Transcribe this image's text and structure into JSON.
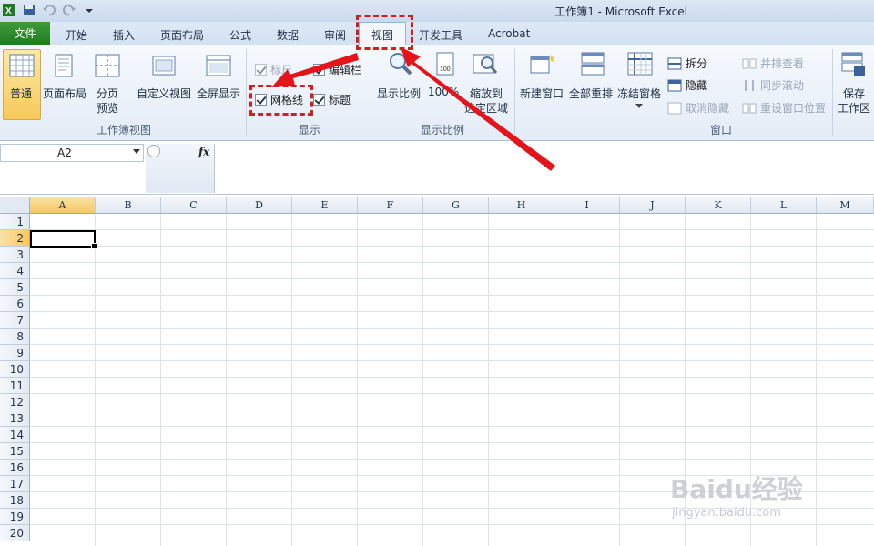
{
  "window": {
    "title": "工作簿1 - Microsoft Excel"
  },
  "tabs": {
    "file": "文件",
    "home": "开始",
    "insert": "插入",
    "page_layout": "页面布局",
    "formulas": "公式",
    "data": "数据",
    "review": "审阅",
    "view": "视图",
    "developer": "开发工具",
    "acrobat": "Acrobat"
  },
  "ribbon": {
    "workbook_views": {
      "label": "工作簿视图",
      "normal": "普通",
      "page_layout": "页面布局",
      "page_break_1": "分页",
      "page_break_2": "预览",
      "custom_views": "自定义视图",
      "full_screen": "全屏显示"
    },
    "show": {
      "label": "显示",
      "ruler": "标尺",
      "formula_bar": "编辑栏",
      "gridlines": "网格线",
      "headings": "标题"
    },
    "zoom": {
      "label": "显示比例",
      "zoom": "显示比例",
      "hundred": "100%",
      "zoom_to_selection_1": "缩放到",
      "zoom_to_selection_2": "选定区域"
    },
    "window": {
      "label": "窗口",
      "new_window": "新建窗口",
      "arrange_all": "全部重排",
      "freeze_panes": "冻结窗格",
      "split": "拆分",
      "hide": "隐藏",
      "unhide": "取消隐藏",
      "side_by_side": "并排查看",
      "sync_scroll": "同步滚动",
      "reset_position": "重设窗口位置",
      "save_workspace_1": "保存",
      "save_workspace_2": "工作区"
    }
  },
  "formula_bar": {
    "name_box": "A2",
    "fx": "fx"
  },
  "sheet": {
    "columns": [
      "A",
      "B",
      "C",
      "D",
      "E",
      "F",
      "G",
      "H",
      "I",
      "J",
      "K",
      "L",
      "M"
    ],
    "rows": [
      "1",
      "2",
      "3",
      "4",
      "5",
      "6",
      "7",
      "8",
      "9",
      "10",
      "11",
      "12",
      "13",
      "14",
      "15",
      "16",
      "17",
      "18",
      "19",
      "20"
    ],
    "selected_column": "A",
    "selected_row": "2"
  },
  "watermark": {
    "main": "Baidu经验",
    "sub": "jingyan.baidu.com"
  },
  "colors": {
    "highlight": "#d81c1c",
    "file_tab": "#2a8a2a",
    "selection": "#f5c863"
  }
}
